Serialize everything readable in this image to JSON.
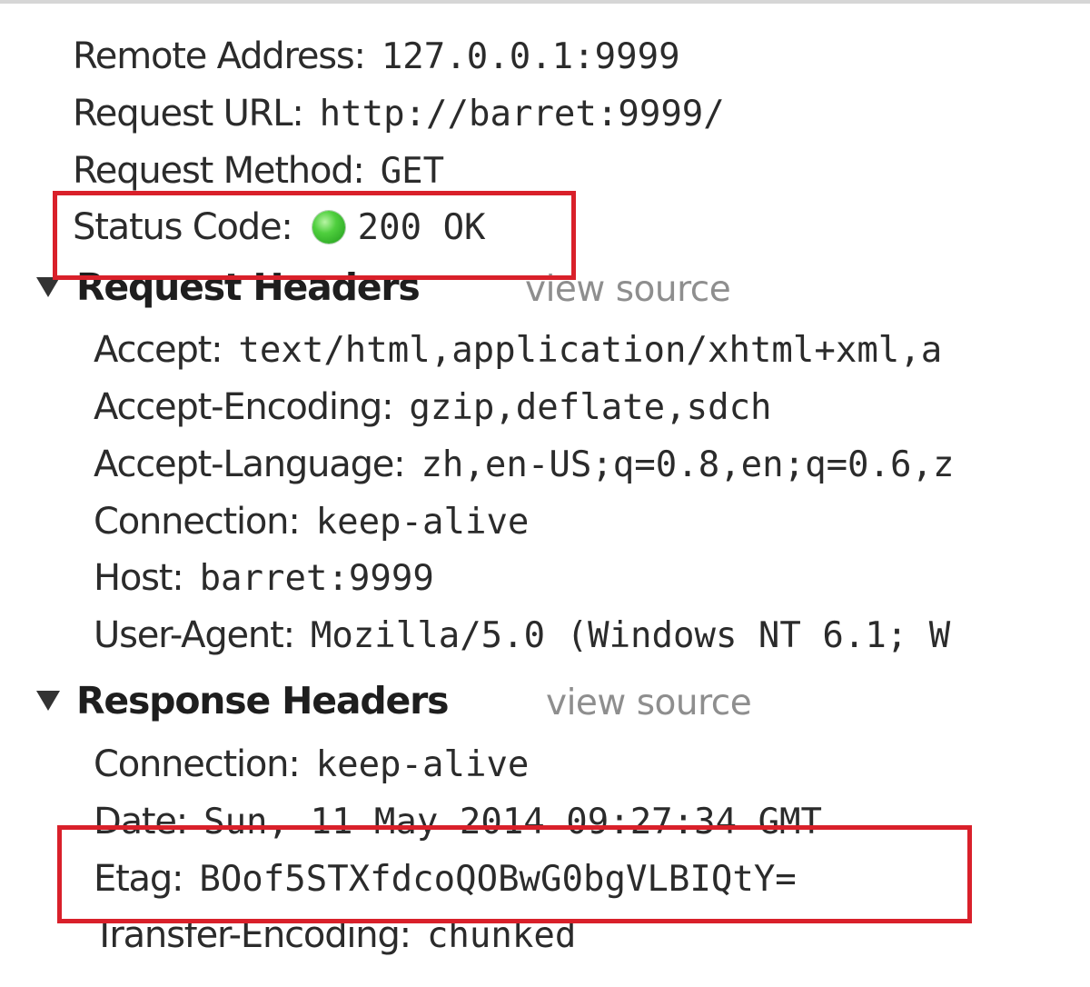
{
  "general": [
    {
      "key": "Remote Address:",
      "value": "127.0.0.1:9999"
    },
    {
      "key": "Request URL:",
      "value": "http://barret:9999/"
    },
    {
      "key": "Request Method:",
      "value": "GET"
    }
  ],
  "status": {
    "key": "Status Code:",
    "value": "200 OK",
    "dot_color": "#3cba2e"
  },
  "request_headers": {
    "title": "Request Headers",
    "view_source": "view source",
    "items": [
      {
        "key": "Accept:",
        "value": "text/html,application/xhtml+xml,a"
      },
      {
        "key": "Accept-Encoding:",
        "value": "gzip,deflate,sdch"
      },
      {
        "key": "Accept-Language:",
        "value": "zh,en-US;q=0.8,en;q=0.6,z"
      },
      {
        "key": "Connection:",
        "value": "keep-alive"
      },
      {
        "key": "Host:",
        "value": "barret:9999"
      },
      {
        "key": "User-Agent:",
        "value": "Mozilla/5.0 (Windows NT 6.1; W"
      }
    ]
  },
  "response_headers": {
    "title": "Response Headers",
    "view_source": "view source",
    "items": [
      {
        "key": "Connection:",
        "value": "keep-alive"
      },
      {
        "key": "Date:",
        "value": "Sun, 11 May 2014 09:27:34 GMT"
      },
      {
        "key": "Etag:",
        "value": "BOof5STXfdcoQOBwG0bgVLBIQtY="
      },
      {
        "key": "Transfer-Encoding:",
        "value": "chunked"
      }
    ]
  },
  "highlight_color": "#d9202a"
}
